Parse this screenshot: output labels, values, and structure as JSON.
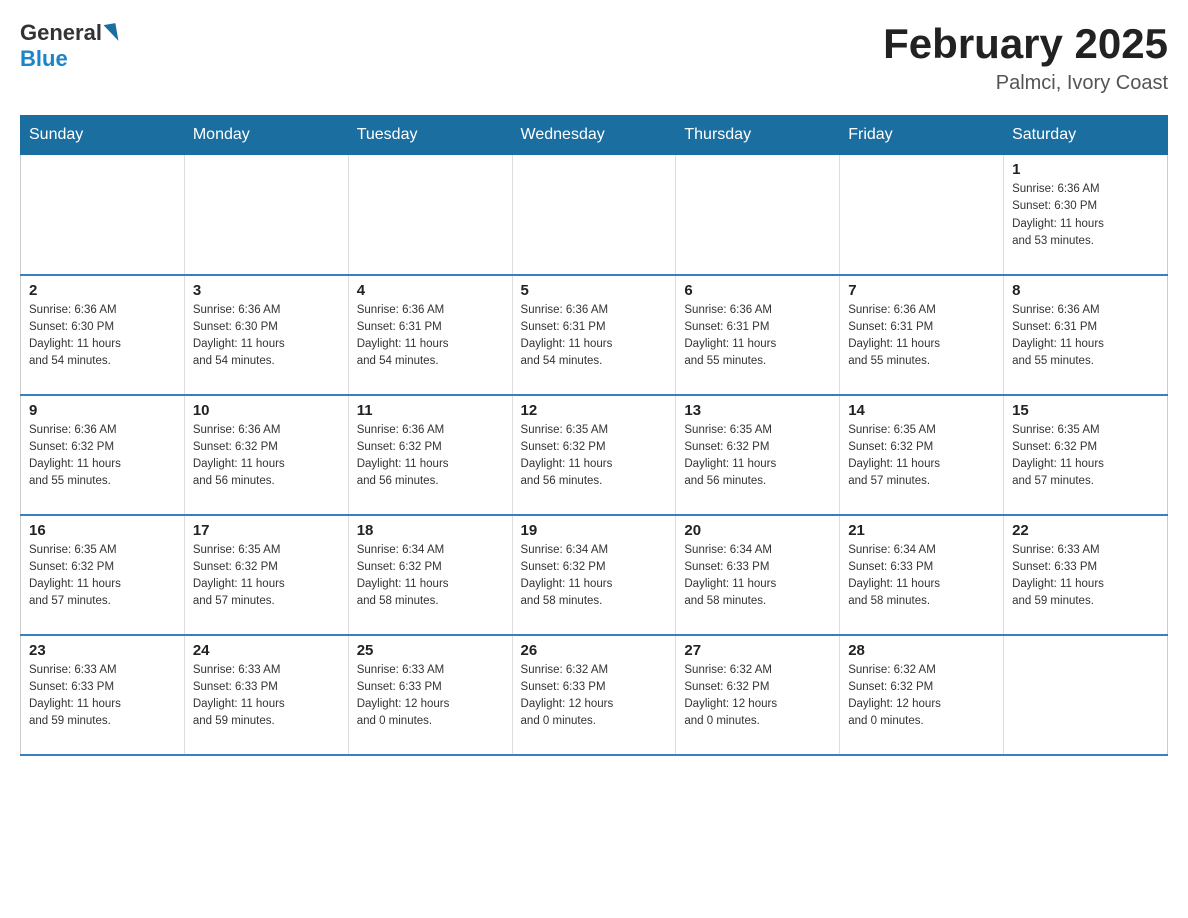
{
  "header": {
    "logo_general": "General",
    "logo_blue": "Blue",
    "title": "February 2025",
    "location": "Palmci, Ivory Coast"
  },
  "calendar": {
    "days_of_week": [
      "Sunday",
      "Monday",
      "Tuesday",
      "Wednesday",
      "Thursday",
      "Friday",
      "Saturday"
    ],
    "weeks": [
      [
        {
          "day": "",
          "info": "",
          "empty": true
        },
        {
          "day": "",
          "info": "",
          "empty": true
        },
        {
          "day": "",
          "info": "",
          "empty": true
        },
        {
          "day": "",
          "info": "",
          "empty": true
        },
        {
          "day": "",
          "info": "",
          "empty": true
        },
        {
          "day": "",
          "info": "",
          "empty": true
        },
        {
          "day": "1",
          "info": "Sunrise: 6:36 AM\nSunset: 6:30 PM\nDaylight: 11 hours\nand 53 minutes.",
          "empty": false
        }
      ],
      [
        {
          "day": "2",
          "info": "Sunrise: 6:36 AM\nSunset: 6:30 PM\nDaylight: 11 hours\nand 54 minutes.",
          "empty": false
        },
        {
          "day": "3",
          "info": "Sunrise: 6:36 AM\nSunset: 6:30 PM\nDaylight: 11 hours\nand 54 minutes.",
          "empty": false
        },
        {
          "day": "4",
          "info": "Sunrise: 6:36 AM\nSunset: 6:31 PM\nDaylight: 11 hours\nand 54 minutes.",
          "empty": false
        },
        {
          "day": "5",
          "info": "Sunrise: 6:36 AM\nSunset: 6:31 PM\nDaylight: 11 hours\nand 54 minutes.",
          "empty": false
        },
        {
          "day": "6",
          "info": "Sunrise: 6:36 AM\nSunset: 6:31 PM\nDaylight: 11 hours\nand 55 minutes.",
          "empty": false
        },
        {
          "day": "7",
          "info": "Sunrise: 6:36 AM\nSunset: 6:31 PM\nDaylight: 11 hours\nand 55 minutes.",
          "empty": false
        },
        {
          "day": "8",
          "info": "Sunrise: 6:36 AM\nSunset: 6:31 PM\nDaylight: 11 hours\nand 55 minutes.",
          "empty": false
        }
      ],
      [
        {
          "day": "9",
          "info": "Sunrise: 6:36 AM\nSunset: 6:32 PM\nDaylight: 11 hours\nand 55 minutes.",
          "empty": false
        },
        {
          "day": "10",
          "info": "Sunrise: 6:36 AM\nSunset: 6:32 PM\nDaylight: 11 hours\nand 56 minutes.",
          "empty": false
        },
        {
          "day": "11",
          "info": "Sunrise: 6:36 AM\nSunset: 6:32 PM\nDaylight: 11 hours\nand 56 minutes.",
          "empty": false
        },
        {
          "day": "12",
          "info": "Sunrise: 6:35 AM\nSunset: 6:32 PM\nDaylight: 11 hours\nand 56 minutes.",
          "empty": false
        },
        {
          "day": "13",
          "info": "Sunrise: 6:35 AM\nSunset: 6:32 PM\nDaylight: 11 hours\nand 56 minutes.",
          "empty": false
        },
        {
          "day": "14",
          "info": "Sunrise: 6:35 AM\nSunset: 6:32 PM\nDaylight: 11 hours\nand 57 minutes.",
          "empty": false
        },
        {
          "day": "15",
          "info": "Sunrise: 6:35 AM\nSunset: 6:32 PM\nDaylight: 11 hours\nand 57 minutes.",
          "empty": false
        }
      ],
      [
        {
          "day": "16",
          "info": "Sunrise: 6:35 AM\nSunset: 6:32 PM\nDaylight: 11 hours\nand 57 minutes.",
          "empty": false
        },
        {
          "day": "17",
          "info": "Sunrise: 6:35 AM\nSunset: 6:32 PM\nDaylight: 11 hours\nand 57 minutes.",
          "empty": false
        },
        {
          "day": "18",
          "info": "Sunrise: 6:34 AM\nSunset: 6:32 PM\nDaylight: 11 hours\nand 58 minutes.",
          "empty": false
        },
        {
          "day": "19",
          "info": "Sunrise: 6:34 AM\nSunset: 6:32 PM\nDaylight: 11 hours\nand 58 minutes.",
          "empty": false
        },
        {
          "day": "20",
          "info": "Sunrise: 6:34 AM\nSunset: 6:33 PM\nDaylight: 11 hours\nand 58 minutes.",
          "empty": false
        },
        {
          "day": "21",
          "info": "Sunrise: 6:34 AM\nSunset: 6:33 PM\nDaylight: 11 hours\nand 58 minutes.",
          "empty": false
        },
        {
          "day": "22",
          "info": "Sunrise: 6:33 AM\nSunset: 6:33 PM\nDaylight: 11 hours\nand 59 minutes.",
          "empty": false
        }
      ],
      [
        {
          "day": "23",
          "info": "Sunrise: 6:33 AM\nSunset: 6:33 PM\nDaylight: 11 hours\nand 59 minutes.",
          "empty": false
        },
        {
          "day": "24",
          "info": "Sunrise: 6:33 AM\nSunset: 6:33 PM\nDaylight: 11 hours\nand 59 minutes.",
          "empty": false
        },
        {
          "day": "25",
          "info": "Sunrise: 6:33 AM\nSunset: 6:33 PM\nDaylight: 12 hours\nand 0 minutes.",
          "empty": false
        },
        {
          "day": "26",
          "info": "Sunrise: 6:32 AM\nSunset: 6:33 PM\nDaylight: 12 hours\nand 0 minutes.",
          "empty": false
        },
        {
          "day": "27",
          "info": "Sunrise: 6:32 AM\nSunset: 6:32 PM\nDaylight: 12 hours\nand 0 minutes.",
          "empty": false
        },
        {
          "day": "28",
          "info": "Sunrise: 6:32 AM\nSunset: 6:32 PM\nDaylight: 12 hours\nand 0 minutes.",
          "empty": false
        },
        {
          "day": "",
          "info": "",
          "empty": true
        }
      ]
    ]
  }
}
